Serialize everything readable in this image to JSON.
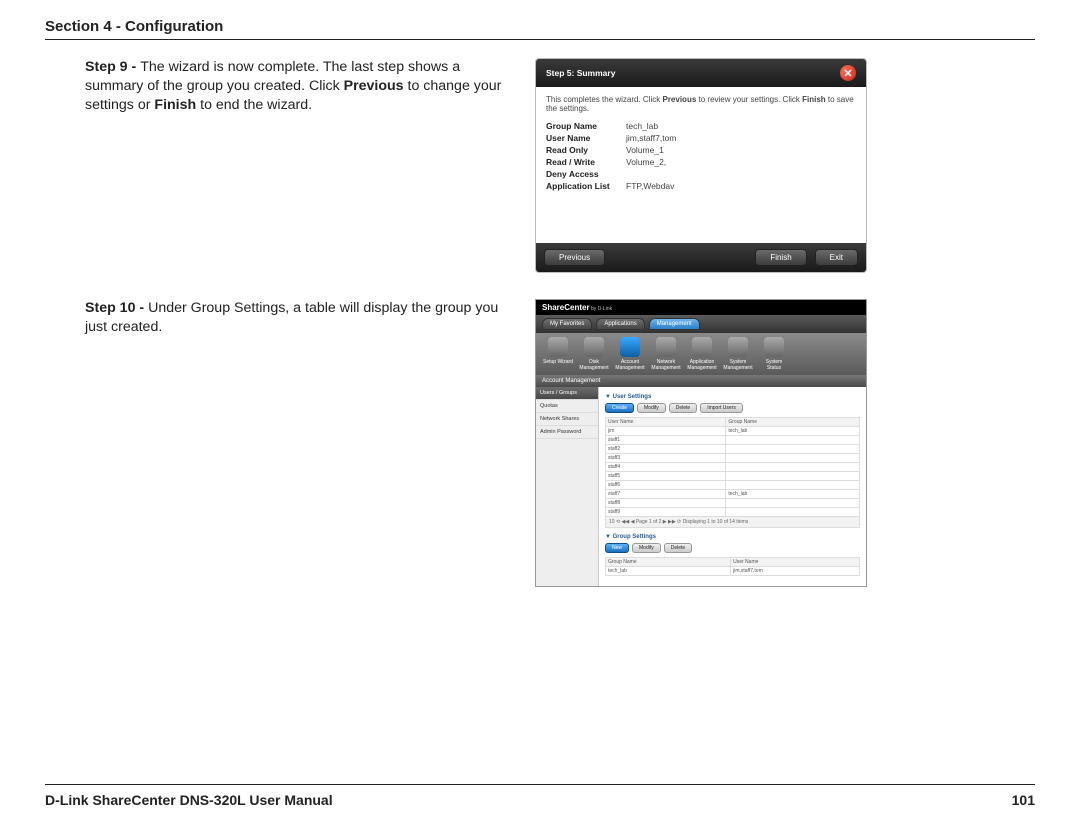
{
  "header": {
    "section_title": "Section 4 - Configuration"
  },
  "step9": {
    "label": "Step 9 - ",
    "text_a": "The wizard is now complete. The last step shows a summary of the group you created. Click ",
    "bold_a": "Previous",
    "text_b": " to change your settings or ",
    "bold_b": "Finish",
    "text_c": " to end the wizard."
  },
  "wizard": {
    "title": "Step 5: Summary",
    "msg_a": "This completes the wizard. Click ",
    "msg_b": "Previous",
    "msg_c": " to review your settings. Click ",
    "msg_d": "Finish",
    "msg_e": " to save the settings.",
    "rows": {
      "group_name_k": "Group Name",
      "group_name_v": "tech_lab",
      "user_name_k": "User Name",
      "user_name_v": "jim,staff7,tom",
      "read_only_k": "Read Only",
      "read_only_v": "Volume_1",
      "read_write_k": "Read / Write",
      "read_write_v": "Volume_2,",
      "deny_k": "Deny Access",
      "deny_v": "",
      "app_k": "Application List",
      "app_v": "FTP,Webdav"
    },
    "btn_prev": "Previous",
    "btn_finish": "Finish",
    "btn_exit": "Exit"
  },
  "step10": {
    "label": "Step 10 - ",
    "text": "Under Group Settings, a table will display the group you just created."
  },
  "mgmt": {
    "brand": "ShareCenter",
    "brand_sub": " by D-Link",
    "tabs": {
      "fav": "My Favorites",
      "apps": "Applications",
      "mgmt": "Management"
    },
    "icons": {
      "setup": "Setup Wizard",
      "disk": "Disk Management",
      "account": "Account Management",
      "network": "Network Management",
      "app": "Application Management",
      "system": "System Management",
      "status": "System Status"
    },
    "bar": "Account Management",
    "side": {
      "users": "Users / Groups",
      "quotas": "Quotas",
      "shares": "Network Shares",
      "admin": "Admin Password"
    },
    "user_settings": {
      "title": "User Settings",
      "btn_create": "Create",
      "btn_modify": "Modify",
      "btn_delete": "Delete",
      "btn_import": "Import Users",
      "col_user": "User Name",
      "col_group": "Group Name",
      "rows": [
        {
          "u": "jim",
          "g": "tech_lab"
        },
        {
          "u": "staff1",
          "g": ""
        },
        {
          "u": "staff2",
          "g": ""
        },
        {
          "u": "staff3",
          "g": ""
        },
        {
          "u": "staff4",
          "g": ""
        },
        {
          "u": "staff5",
          "g": ""
        },
        {
          "u": "staff6",
          "g": ""
        },
        {
          "u": "staff7",
          "g": "tech_lab"
        },
        {
          "u": "staff8",
          "g": ""
        },
        {
          "u": "staff9",
          "g": ""
        }
      ],
      "pager": "10  ⟲  ◀◀ ◀  Page 1 of 2  ▶ ▶▶  ⟳   Displaying 1 to 10 of 14 items"
    },
    "group_settings": {
      "title": "Group Settings",
      "btn_new": "New",
      "btn_modify": "Modify",
      "btn_delete": "Delete",
      "col_group": "Group Name",
      "col_user": "User Name",
      "row": {
        "g": "tech_lab",
        "u": "jim,staff7,tom"
      }
    }
  },
  "footer": {
    "manual": "D-Link ShareCenter DNS-320L User Manual",
    "page": "101"
  }
}
